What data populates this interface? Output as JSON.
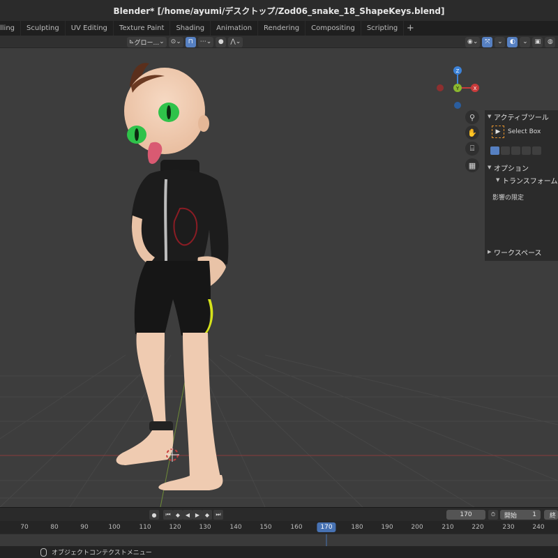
{
  "window": {
    "title": "Blender* [/home/ayumi/デスクトップ/Zod06_snake_18_ShapeKeys.blend]"
  },
  "workspace_tabs": [
    "lling",
    "Sculpting",
    "UV Editing",
    "Texture Paint",
    "Shading",
    "Animation",
    "Rendering",
    "Compositing",
    "Scripting"
  ],
  "workspace_add": "+",
  "header": {
    "transform_orientation": "グロー...",
    "chevron": "⌄"
  },
  "sidebar": {
    "active_tool_title": "アクティブツール",
    "tool_name": "Select Box",
    "options_title": "オプション",
    "transform_title": "トランスフォーム",
    "limit_label": "影響の限定",
    "workspace_title": "ワークスペース"
  },
  "gizmo": {
    "x": "X",
    "y": "Y",
    "z": "Z"
  },
  "icons": [
    "cursor-icon",
    "hand-icon",
    "camera-icon",
    "grid-icon",
    "zoom-icon",
    "record-icon",
    "mouse-icon"
  ],
  "timeline": {
    "current_frame": "170",
    "start_label": "開始",
    "start_value": "1",
    "end_label": "終",
    "ruler_ticks": [
      "70",
      "80",
      "90",
      "100",
      "110",
      "120",
      "130",
      "140",
      "150",
      "160",
      "170",
      "180",
      "190",
      "200",
      "210",
      "220",
      "230",
      "240"
    ]
  },
  "status": {
    "text": "オブジェクトコンテクストメニュー"
  },
  "colors": {
    "accent": "#5680c2",
    "x_axis": "#c83b3b",
    "y_axis": "#8bb82f",
    "z_axis": "#3c82d8"
  }
}
